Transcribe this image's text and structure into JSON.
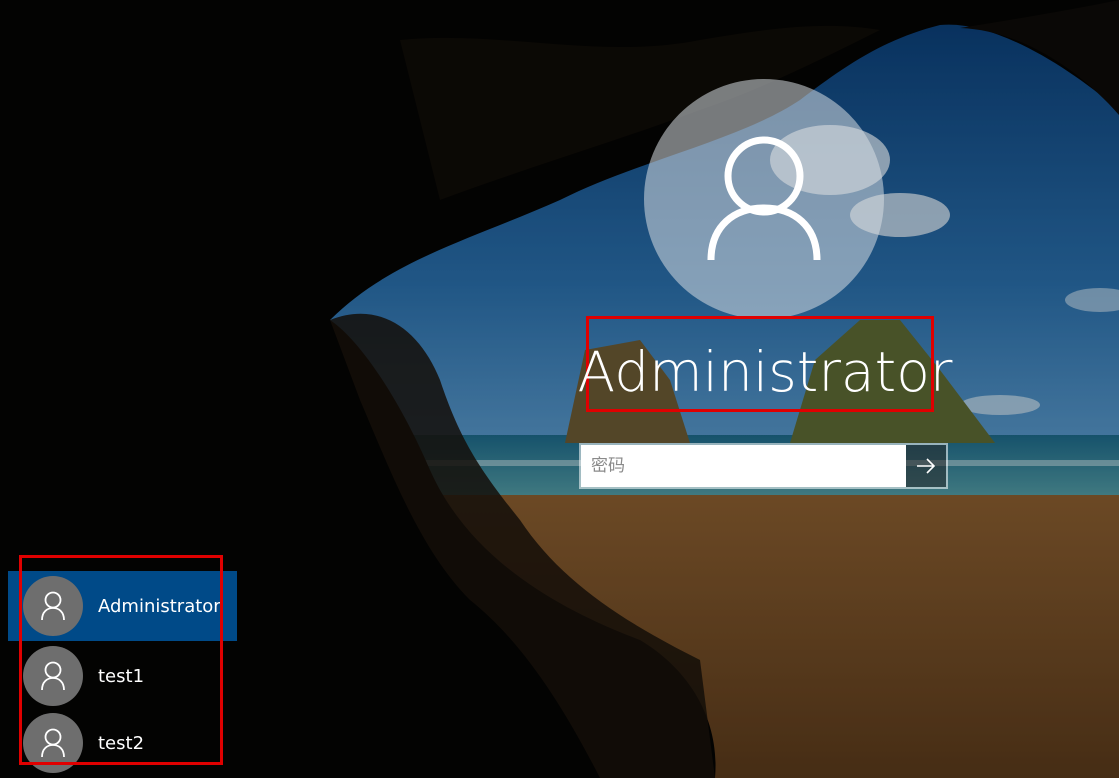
{
  "login": {
    "username": "Administrator",
    "password_placeholder": "密码",
    "submit_icon": "arrow-right-icon",
    "avatar_icon": "user-icon"
  },
  "user_list": [
    {
      "name": "Administrator",
      "selected": true,
      "icon": "user-icon"
    },
    {
      "name": "test1",
      "selected": false,
      "icon": "user-icon"
    },
    {
      "name": "test2",
      "selected": false,
      "icon": "user-icon"
    }
  ],
  "colors": {
    "selected_tile": "#004a88",
    "highlight_box": "#e00000",
    "tile_avatar": "#6e6e6e"
  }
}
